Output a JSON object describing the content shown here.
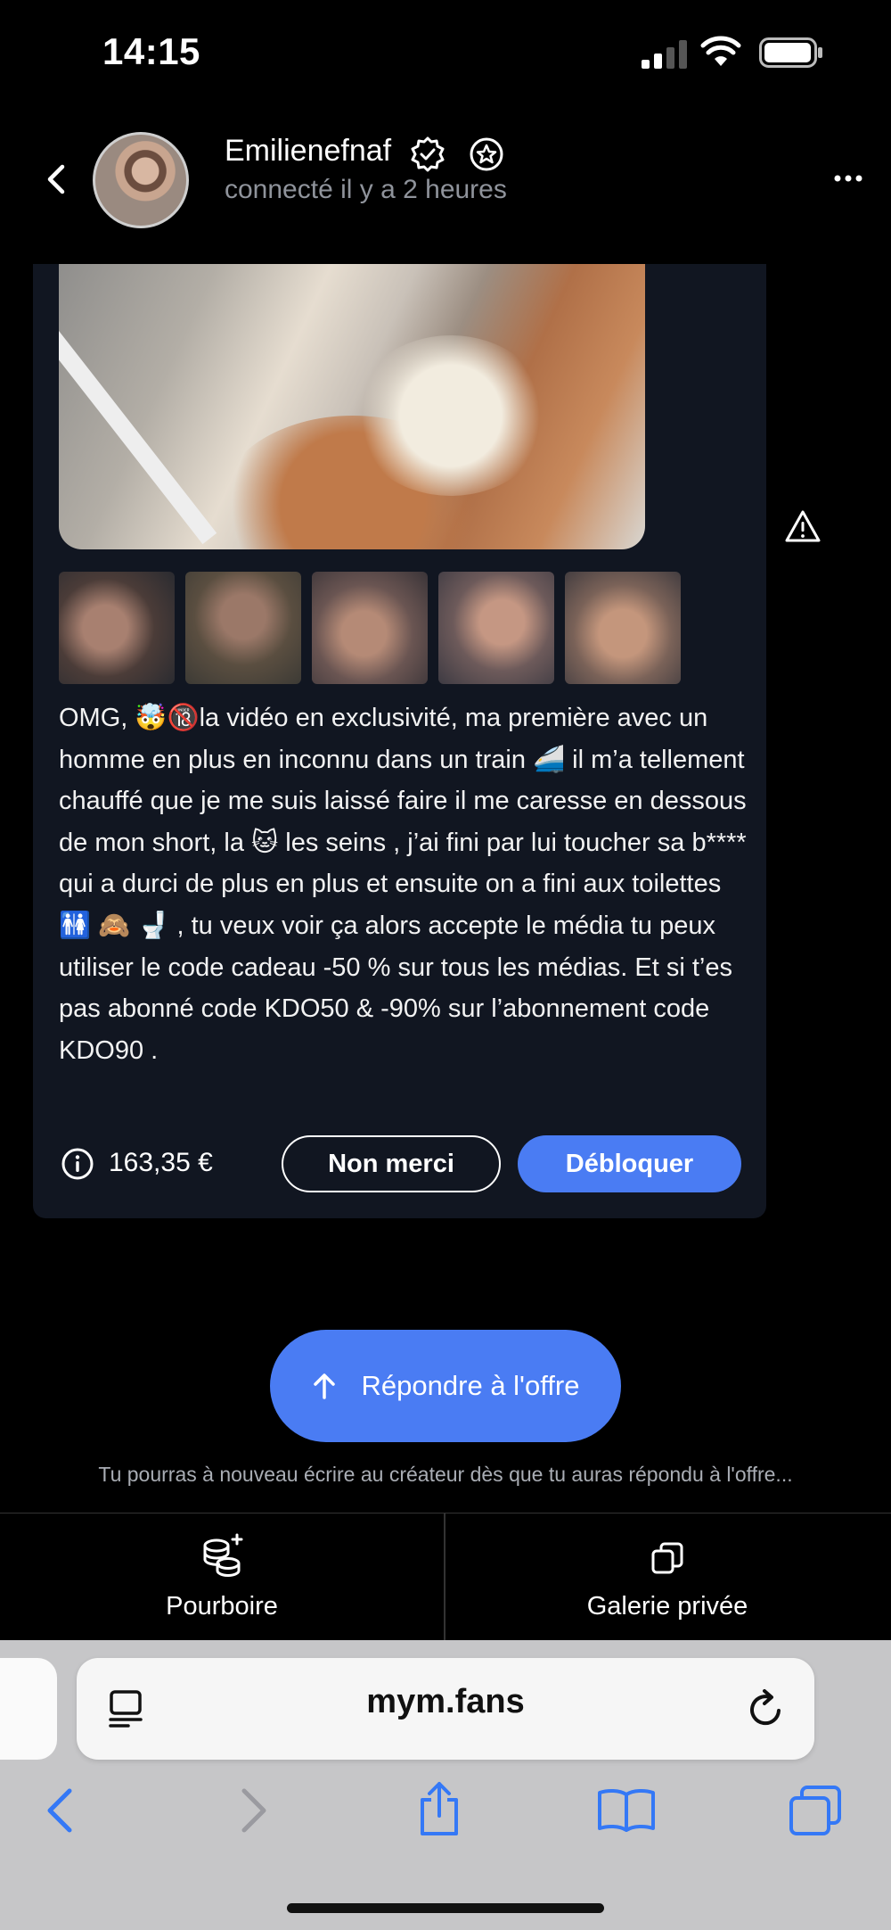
{
  "status_bar": {
    "time": "14:15"
  },
  "header": {
    "name": "Emilienefnaf",
    "status": "connecté il y a 2 heures",
    "icons": [
      "back-chevron-icon",
      "verified-badge-icon",
      "star-badge-icon",
      "more-dots-icon"
    ]
  },
  "message": {
    "text": "OMG, 🤯🔞la vidéo en exclusivité, ma première avec un homme en plus en inconnu dans un train 🚄 il m’a tellement chauffé que je me suis laissé faire il me caresse en dessous de mon short, la 🐱 les seins , j’ai fini par lui toucher sa b**** qui a durci de plus en plus et ensuite on a fini aux toilettes 🚻 🙈 🚽 , tu veux voir ça alors accepte le média tu peux utiliser le code cadeau -50 % sur tous les médias. Et si t’es pas abonné code KDO50 & -90% sur l’abonnement code KDO90 .",
    "price": "163,35 €",
    "decline_label": "Non merci",
    "unlock_label": "Débloquer",
    "thumbnail_count": 5
  },
  "reply": {
    "button_label": "Répondre à l'offre",
    "note": "Tu pourras à nouveau écrire au créateur dès que tu auras répondu à l'offre..."
  },
  "actions": {
    "tip_label": "Pourboire",
    "gallery_label": "Galerie privée"
  },
  "browser": {
    "url": "mym.fans"
  },
  "colors": {
    "accent": "#4a7cf3",
    "card_bg": "#111621",
    "safari_bg": "#c6c6c8",
    "safari_icon": "#3478f6"
  }
}
